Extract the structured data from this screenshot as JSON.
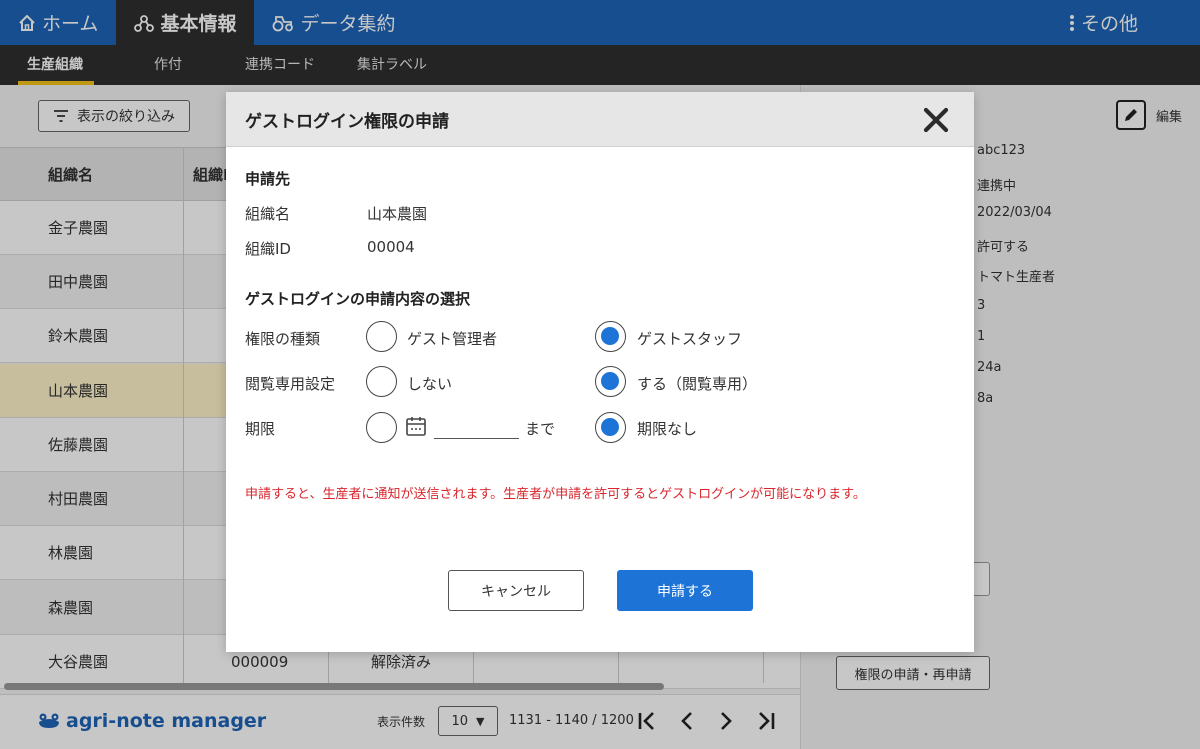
{
  "topnav": {
    "home_label": "ホーム",
    "basic_label": "基本情報",
    "data_label": "データ集約",
    "other_label": "その他"
  },
  "subnav": {
    "items": [
      "生産組織",
      "作付",
      "連携コード",
      "集計ラベル"
    ]
  },
  "filter": {
    "label": "表示の絞り込み"
  },
  "table": {
    "headers": [
      "組織名",
      "組織I"
    ],
    "rows": [
      {
        "name": "金子農園"
      },
      {
        "name": "田中農園"
      },
      {
        "name": "鈴木農園"
      },
      {
        "name": "山本農園"
      },
      {
        "name": "佐藤農園"
      },
      {
        "name": "村田農園"
      },
      {
        "name": "林農園"
      },
      {
        "name": "森農園"
      },
      {
        "name": "大谷農園",
        "id": "000009",
        "status": "解除済み"
      }
    ]
  },
  "detail": {
    "edit_label": "編集",
    "values": [
      "abc123",
      "連携中",
      "2022/03/04",
      "許可する",
      "トマト生産者",
      "3",
      "1",
      "24a",
      "8a"
    ],
    "request_button": "権限の申請・再申請"
  },
  "footer": {
    "logo": "agri-note manager",
    "perpage_label": "表示件数",
    "perpage_value": "10",
    "range": "1131 - 1140 / 1200"
  },
  "modal": {
    "title": "ゲストログイン権限の申請",
    "target_section": "申請先",
    "org_name_label": "組織名",
    "org_name_value": "山本農園",
    "org_id_label": "組織ID",
    "org_id_value": "00004",
    "choice_section": "ゲストログインの申請内容の選択",
    "permission_type_label": "権限の種類",
    "permission_option_admin": "ゲスト管理者",
    "permission_option_staff": "ゲストスタッフ",
    "readonly_label": "閲覧専用設定",
    "readonly_option_no": "しない",
    "readonly_option_yes": "する（閲覧専用）",
    "period_label": "期限",
    "period_until": "まで",
    "period_option_none": "期限なし",
    "warning": "申請すると、生産者に通知が送信されます。生産者が申請を許可するとゲストログインが可能になります。",
    "cancel_label": "キャンセル",
    "submit_label": "申請する"
  },
  "colors": {
    "nav_blue": "#1e64b8",
    "accent_blue": "#1e74d6",
    "warning_red": "#d9262c",
    "active_underline": "#f5c518"
  }
}
